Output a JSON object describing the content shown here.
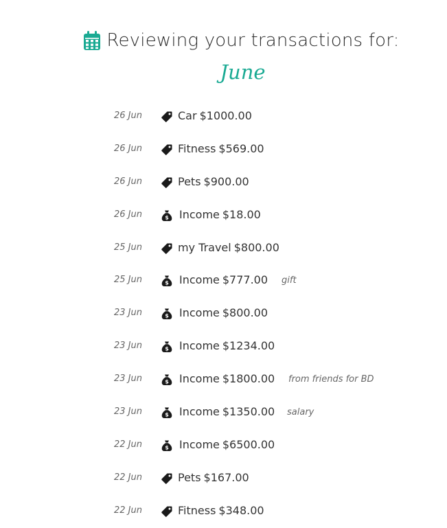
{
  "header": {
    "icon": "calendar-icon",
    "title": "Reviewing your transactions for:",
    "month": "June",
    "accent_color": "#1aaa93"
  },
  "transactions": [
    {
      "date": "26 Jun",
      "type": "expense",
      "icon": "tag-icon",
      "category": "Car",
      "amount": "$1000.00",
      "note": ""
    },
    {
      "date": "26 Jun",
      "type": "expense",
      "icon": "tag-icon",
      "category": "Fitness",
      "amount": "$569.00",
      "note": ""
    },
    {
      "date": "26 Jun",
      "type": "expense",
      "icon": "tag-icon",
      "category": "Pets",
      "amount": "$900.00",
      "note": ""
    },
    {
      "date": "26 Jun",
      "type": "income",
      "icon": "money-bag-icon",
      "category": "Income",
      "amount": "$18.00",
      "note": ""
    },
    {
      "date": "25 Jun",
      "type": "expense",
      "icon": "tag-icon",
      "category": "my Travel",
      "amount": "$800.00",
      "note": ""
    },
    {
      "date": "25 Jun",
      "type": "income",
      "icon": "money-bag-icon",
      "category": "Income",
      "amount": "$777.00",
      "note": "gift"
    },
    {
      "date": "23 Jun",
      "type": "income",
      "icon": "money-bag-icon",
      "category": "Income",
      "amount": "$800.00",
      "note": ""
    },
    {
      "date": "23 Jun",
      "type": "income",
      "icon": "money-bag-icon",
      "category": "Income",
      "amount": "$1234.00",
      "note": ""
    },
    {
      "date": "23 Jun",
      "type": "income",
      "icon": "money-bag-icon",
      "category": "Income",
      "amount": "$1800.00",
      "note": "from friends for BD"
    },
    {
      "date": "23 Jun",
      "type": "income",
      "icon": "money-bag-icon",
      "category": "Income",
      "amount": "$1350.00",
      "note": "salary"
    },
    {
      "date": "22 Jun",
      "type": "income",
      "icon": "money-bag-icon",
      "category": "Income",
      "amount": "$6500.00",
      "note": ""
    },
    {
      "date": "22 Jun",
      "type": "expense",
      "icon": "tag-icon",
      "category": "Pets",
      "amount": "$167.00",
      "note": ""
    },
    {
      "date": "22 Jun",
      "type": "expense",
      "icon": "tag-icon",
      "category": "Fitness",
      "amount": "$348.00",
      "note": ""
    }
  ]
}
